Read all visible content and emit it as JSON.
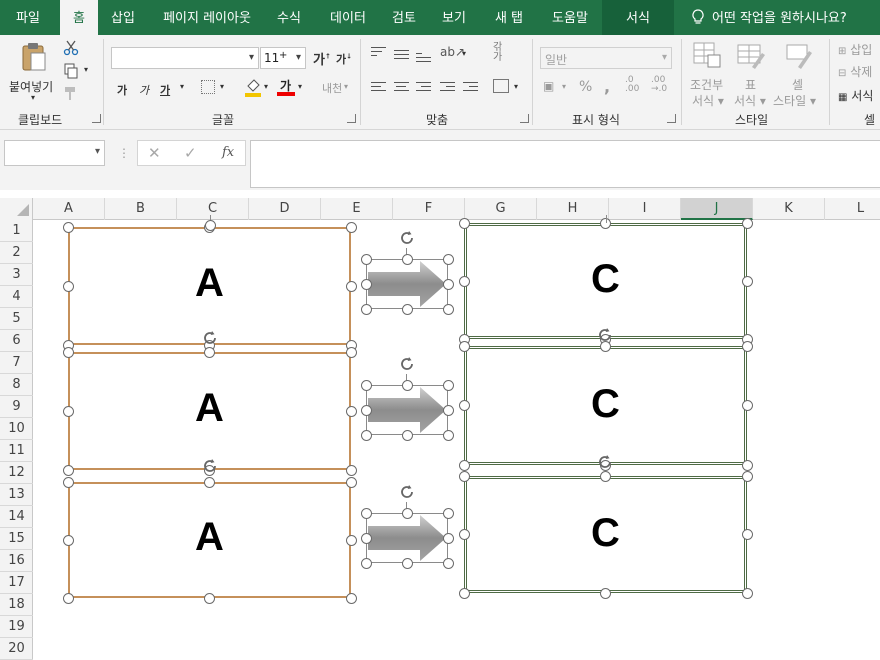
{
  "tabs": {
    "file": "파일",
    "home": "홈",
    "insert": "삽입",
    "page_layout": "페이지 레이아웃",
    "formulas": "수식",
    "data": "데이터",
    "review": "검토",
    "view": "보기",
    "new_tab": "새 탭",
    "help": "도움말",
    "format": "서식",
    "tell_me": "어떤 작업을 원하시나요?"
  },
  "ribbon": {
    "clipboard": {
      "paste_label": "붙여넣기",
      "group_label": "클립보드"
    },
    "font": {
      "font_name": "",
      "font_size": "11",
      "group_label": "글꼴",
      "bold": "가",
      "italic": "가",
      "underline": "가"
    },
    "alignment": {
      "group_label": "맞춤"
    },
    "number": {
      "format_value": "일반",
      "percent": "%",
      "comma": ",",
      "group_label": "표시 형식"
    },
    "styles": {
      "conditional_line1": "조건부",
      "conditional_line2": "서식",
      "table_line1": "표",
      "table_line2": "서식",
      "cell_line1": "셀",
      "cell_line2": "스타일",
      "group_label": "스타일"
    },
    "cells": {
      "insert": "삽입",
      "delete": "삭제",
      "format": "서식",
      "group_label": "셀"
    }
  },
  "formula_bar": {
    "name_box": "",
    "fx": "fx",
    "content": ""
  },
  "grid": {
    "columns": [
      "A",
      "B",
      "C",
      "D",
      "E",
      "F",
      "G",
      "H",
      "I",
      "J",
      "K",
      "L"
    ],
    "selected_column": "J",
    "rows": [
      "1",
      "2",
      "3",
      "4",
      "5",
      "6",
      "7",
      "8",
      "9",
      "10",
      "11",
      "12",
      "13",
      "14",
      "15",
      "16",
      "17",
      "18",
      "19",
      "20"
    ]
  },
  "shapes": {
    "left_boxes": [
      "A",
      "A",
      "A"
    ],
    "right_boxes": [
      "C",
      "C",
      "C"
    ],
    "colors": {
      "left_border": "#c5905a",
      "right_border": "#4f6b45",
      "arrow": "#8c8c8c"
    }
  }
}
